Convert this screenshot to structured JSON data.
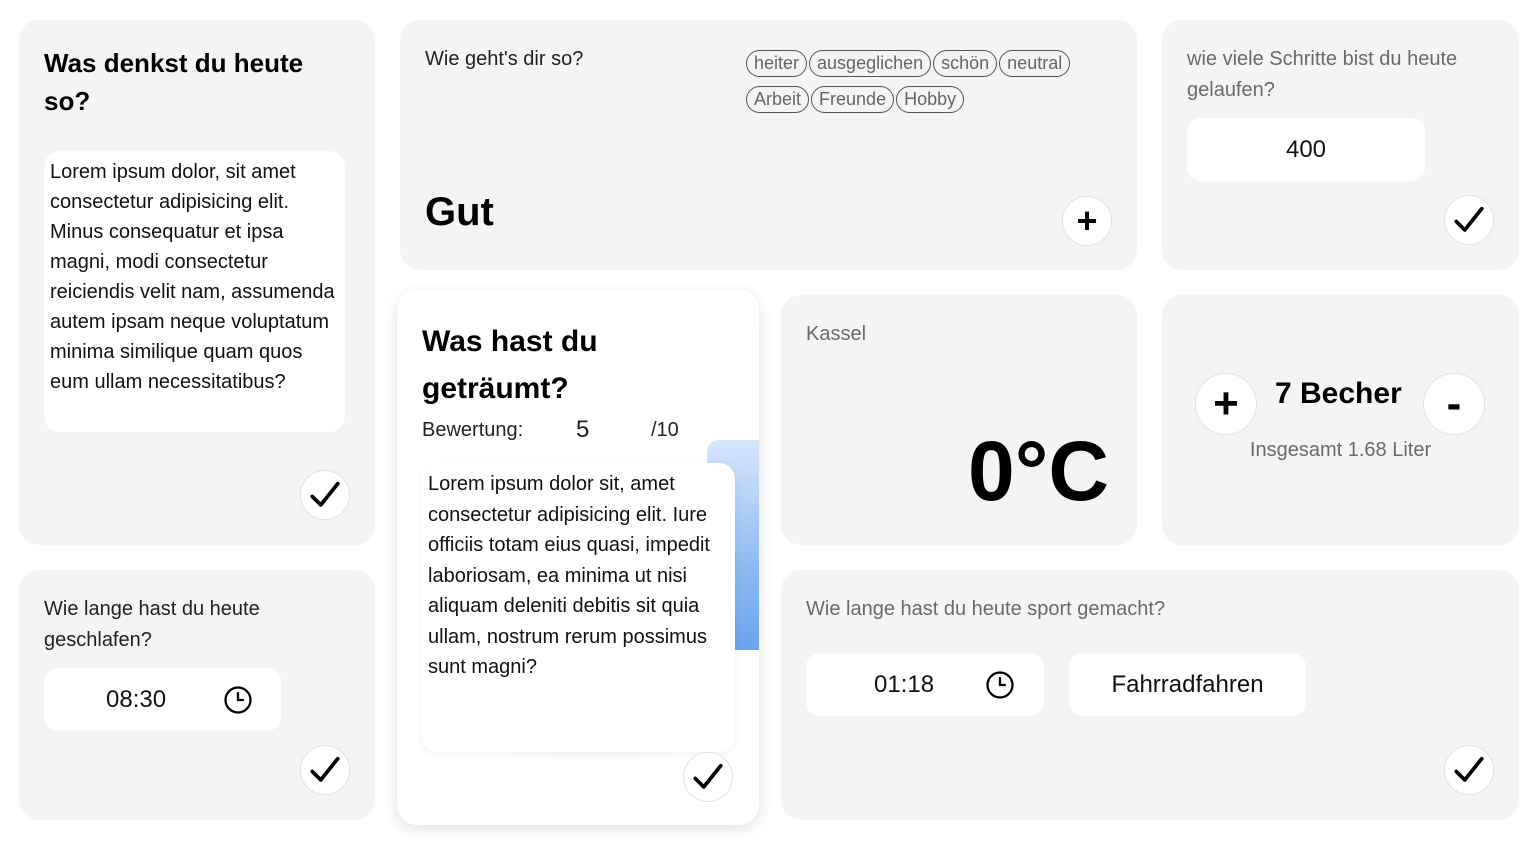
{
  "thoughts": {
    "title": "Was denkst du heute so?",
    "text": "Lorem ipsum dolor, sit amet consectetur adipisicing elit. Minus consequatur et ipsa magni, modi consectetur reiciendis velit nam, assumenda autem ipsam neque voluptatum minima similique quam quos eum ullam necessitatibus?"
  },
  "mood": {
    "question": "Wie geht's dir so?",
    "value": "Gut",
    "tags": [
      "heiter",
      "ausgeglichen",
      "schön",
      "neutral",
      "Arbeit",
      "Freunde",
      "Hobby"
    ],
    "add_symbol": "+"
  },
  "steps": {
    "question": "wie viele Schritte bist du heute gelaufen?",
    "value": "400"
  },
  "dream": {
    "title": "Was hast du geträumt?",
    "rating_label": "Bewertung:",
    "rating_value": "5",
    "rating_max": "/10",
    "text": " Lorem ipsum dolor sit, amet consectetur adipisicing elit. Iure officiis totam eius quasi, impedit laboriosam, ea minima ut nisi aliquam deleniti debitis sit quia ullam, nostrum rerum possimus sunt magni?"
  },
  "weather": {
    "city": "Kassel",
    "temperature": "0°C"
  },
  "water": {
    "plus_symbol": "+",
    "minus_symbol": "-",
    "count_label": "7 Becher",
    "total_label": "Insgesamt 1.68 Liter"
  },
  "sleep": {
    "question": "Wie lange hast du heute geschlafen?",
    "time": "08:30"
  },
  "sport": {
    "question": "Wie lange hast du heute sport gemacht?",
    "time": "01:18",
    "activity": "Fahrradfahren"
  },
  "icons": {
    "check": "check-icon",
    "clock": "clock-icon",
    "plus": "plus-icon"
  }
}
